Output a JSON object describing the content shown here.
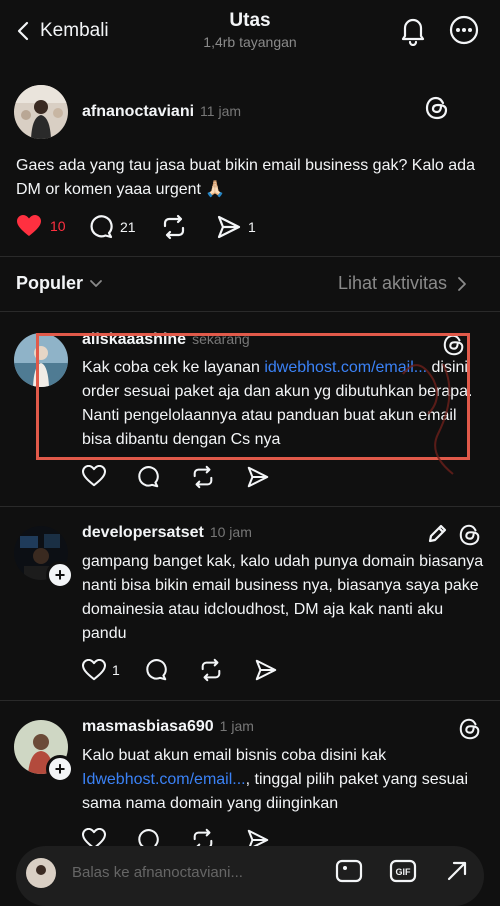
{
  "header": {
    "back_label": "Kembali",
    "title": "Utas",
    "subtitle": "1,4rb tayangan",
    "icons": [
      "bell-icon",
      "more-icon"
    ]
  },
  "main_post": {
    "username": "afnanoctaviani",
    "time": "11 jam",
    "text": "Gaes ada yang tau jasa buat bikin email business gak? Kalo ada DM or komen yaaa urgent 🙏🏻",
    "likes": "10",
    "comments": "21",
    "shares": "1",
    "colors": {
      "like": "#ff3040"
    }
  },
  "section": {
    "title": "Populer",
    "activity_link": "Lihat aktivitas"
  },
  "replies": [
    {
      "username": "aliskaaashine",
      "time": "sekarang",
      "text_before": "Kak coba cek ke layanan ",
      "link": "idwebhost.com/email...",
      "text_after": " disini order sesuai paket aja dan akun yg dibutuhkan berapa. Nanti pengelolaannya atau panduan buat akun email bisa dibantu dengan Cs nya",
      "likes": ""
    },
    {
      "username": "developersatset",
      "time": "10 jam",
      "text": "gampang banget kak, kalo udah punya domain biasanya nanti bisa bikin email business nya, biasanya saya pake domainesia atau idcloudhost, DM aja kak nanti aku pandu",
      "likes": "1"
    },
    {
      "username": "masmasbiasa690",
      "time": "1 jam",
      "text_before": "Kalo buat akun email bisnis coba disini kak ",
      "link": "Idwebhost.com/email...",
      "text_after": ", tinggal pilih paket yang sesuai sama nama domain yang diinginkan",
      "likes": ""
    }
  ],
  "composer": {
    "placeholder": "Balas ke afnanoctaviani...",
    "icons": [
      "image-icon",
      "gif-icon",
      "expand-icon"
    ]
  },
  "accent_colors": {
    "link": "#3b82f6",
    "highlight_box": "#e15a4a"
  }
}
